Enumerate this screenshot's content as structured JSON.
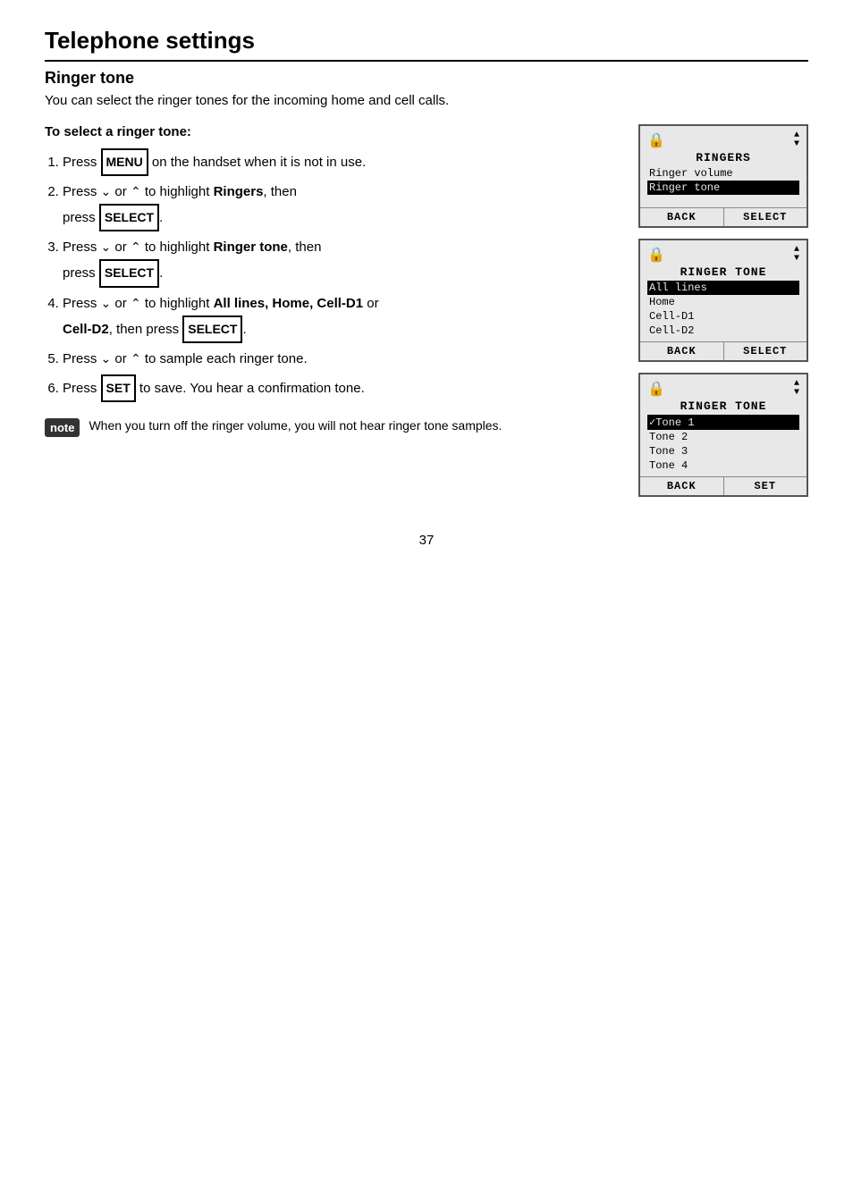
{
  "page": {
    "title": "Telephone settings",
    "section": "Ringer tone",
    "intro": "You can select the ringer tones for the incoming home and cell calls.",
    "sub_heading": "To select a ringer tone:",
    "steps": [
      {
        "id": 1,
        "text_before": "Press ",
        "button": "MENU",
        "text_after": " on the handset when it is not in use."
      },
      {
        "id": 2,
        "text_before": "Press ",
        "arrow_down": "∨",
        "text_or": " or ",
        "arrow_up": "∧",
        "text_highlight": " to highlight ",
        "bold_word": "Ringers",
        "text_then": ", then press ",
        "button": "SELECT",
        "text_end": "."
      },
      {
        "id": 3,
        "text_before": "Press ",
        "arrow_down": "∨",
        "text_or": " or ",
        "arrow_up": "∧",
        "text_highlight": " to highlight ",
        "bold_word": "Ringer tone",
        "text_then": ", then press ",
        "button": "SELECT",
        "text_end": "."
      },
      {
        "id": 4,
        "text_before": "Press ",
        "arrow_down": "∨",
        "text_or": " or ",
        "arrow_up": "∧",
        "text_highlight": " to highlight ",
        "bold_word": "All lines, Home, Cell-D1",
        "text_or2": " or ",
        "bold_word2": "Cell-D2",
        "text_then": ", then press ",
        "button": "SELECT",
        "text_end": "."
      },
      {
        "id": 5,
        "text_before": "Press ",
        "arrow_down": "∨",
        "text_or": " or ",
        "arrow_up": "∧",
        "text_after": " to sample each ringer tone."
      },
      {
        "id": 6,
        "text_before": "Press ",
        "button": "SET",
        "text_after": " to save. You hear a confirmation tone."
      }
    ],
    "note": {
      "label": "note",
      "text": "When you turn off the ringer volume, you will not hear ringer tone samples."
    },
    "screens": [
      {
        "id": "screen1",
        "title": "RINGERS",
        "items": [
          {
            "text": "Ringer volume",
            "highlighted": false
          },
          {
            "text": "Ringer tone",
            "highlighted": true
          }
        ],
        "footer_left": "BACK",
        "footer_right": "SELECT"
      },
      {
        "id": "screen2",
        "title": "RINGER TONE",
        "items": [
          {
            "text": "All lines",
            "highlighted": true
          },
          {
            "text": "Home",
            "highlighted": false
          },
          {
            "text": "Cell-D1",
            "highlighted": false
          },
          {
            "text": "Cell-D2",
            "highlighted": false
          }
        ],
        "footer_left": "BACK",
        "footer_right": "SELECT"
      },
      {
        "id": "screen3",
        "title": "RINGER TONE",
        "items": [
          {
            "text": "✓Tone 1",
            "highlighted": true
          },
          {
            "text": "Tone 2",
            "highlighted": false
          },
          {
            "text": "Tone 3",
            "highlighted": false
          },
          {
            "text": "Tone 4",
            "highlighted": false
          }
        ],
        "footer_left": "BACK",
        "footer_right": "SET"
      }
    ],
    "page_number": "37"
  }
}
